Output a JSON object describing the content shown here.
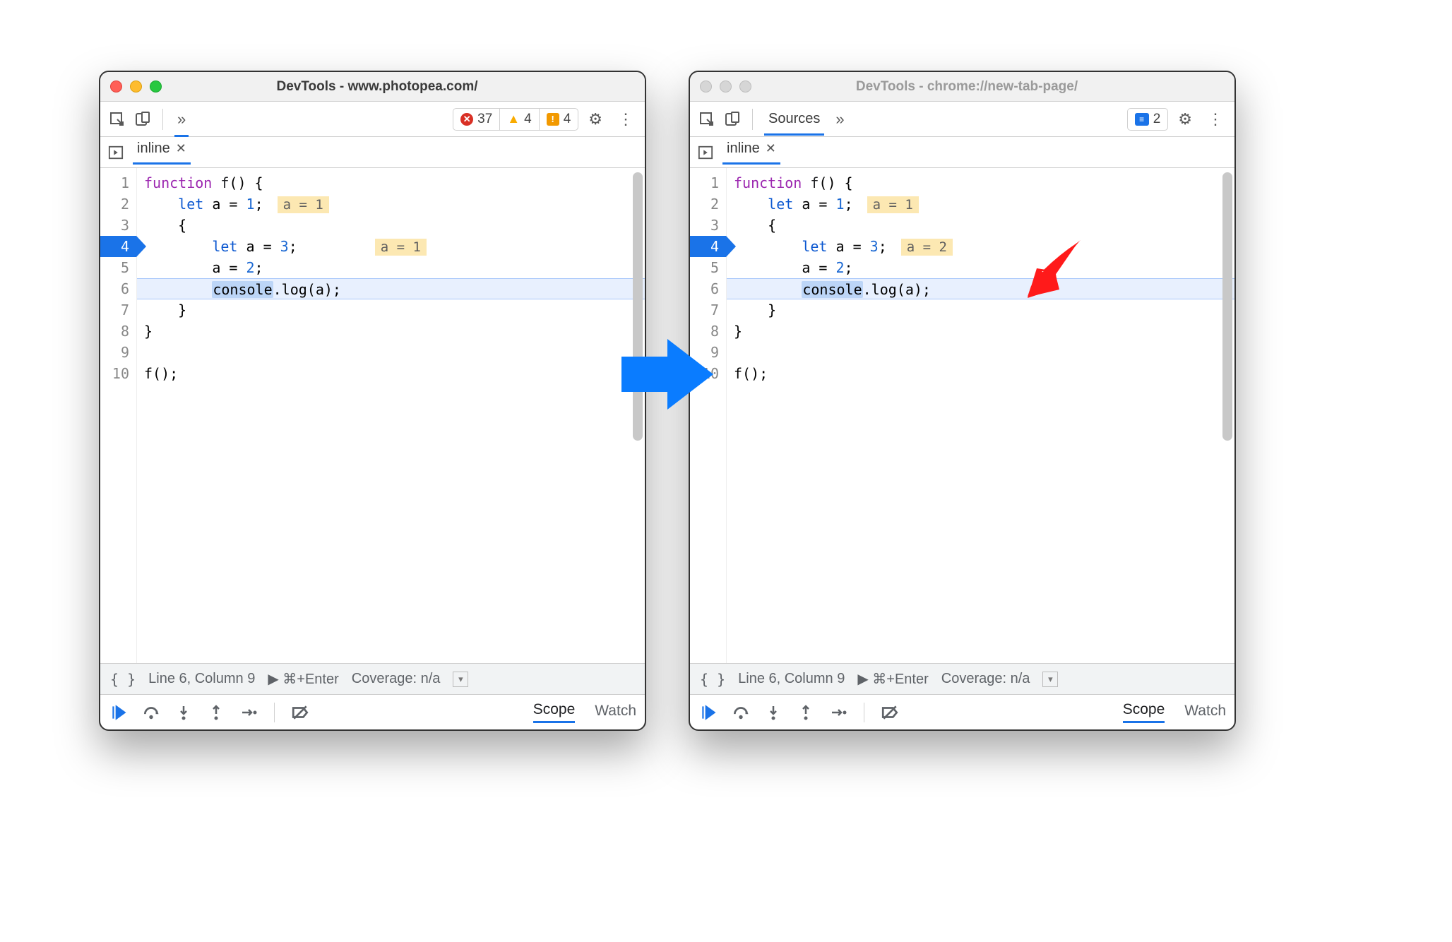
{
  "windows": {
    "left": {
      "title": "DevTools - www.photopea.com/",
      "active": true,
      "badges": {
        "errors": "37",
        "warnings": "4",
        "issues": "4"
      },
      "tabs": {
        "chevron": "»"
      },
      "file_tab": "inline",
      "gutter": [
        "1",
        "2",
        "3",
        "4",
        "5",
        "6",
        "7",
        "8",
        "9",
        "10"
      ],
      "exec_line_index": 3,
      "current_line_index": 5,
      "hints": {
        "line2": "a = 1",
        "line4": "a = 1"
      },
      "code": {
        "l1": {
          "kw": "function",
          "name": "f",
          "rest": "() {"
        },
        "l2": {
          "indent": "    ",
          "kw": "let",
          "assign": " a = ",
          "val": "1",
          "tail": ";"
        },
        "l3": {
          "indent": "    ",
          "brace": "{"
        },
        "l4": {
          "indent": "        ",
          "kw": "let",
          "assign": " a = ",
          "val": "3",
          "tail": ";"
        },
        "l5": {
          "indent": "        ",
          "text": "a = ",
          "val": "2",
          "tail": ";"
        },
        "l6": {
          "indent": "        ",
          "sel": "console",
          "rest": ".log(a);"
        },
        "l7": {
          "indent": "    ",
          "brace": "}"
        },
        "l8": {
          "brace": "}"
        },
        "l9": "",
        "l10": "f();"
      },
      "status": {
        "pos": "Line 6, Column 9",
        "run": "⌘+Enter",
        "coverage": "Coverage: n/a"
      },
      "panes": {
        "scope": "Scope",
        "watch": "Watch"
      }
    },
    "right": {
      "title": "DevTools - chrome://new-tab-page/",
      "active": false,
      "tab_label": "Sources",
      "badges": {
        "messages": "2"
      },
      "tabs": {
        "chevron": "»"
      },
      "file_tab": "inline",
      "gutter": [
        "1",
        "2",
        "3",
        "4",
        "5",
        "6",
        "7",
        "8",
        "9",
        "10"
      ],
      "exec_line_index": 3,
      "current_line_index": 5,
      "hints": {
        "line2": "a = 1",
        "line4": "a = 2"
      },
      "code": {
        "l1": {
          "kw": "function",
          "name": "f",
          "rest": "() {"
        },
        "l2": {
          "indent": "    ",
          "kw": "let",
          "assign": " a = ",
          "val": "1",
          "tail": ";"
        },
        "l3": {
          "indent": "    ",
          "brace": "{"
        },
        "l4": {
          "indent": "        ",
          "kw": "let",
          "assign": " a = ",
          "val": "3",
          "tail": ";"
        },
        "l5": {
          "indent": "        ",
          "text": "a = ",
          "val": "2",
          "tail": ";"
        },
        "l6": {
          "indent": "        ",
          "sel": "console",
          "rest": ".log(a);"
        },
        "l7": {
          "indent": "    ",
          "brace": "}"
        },
        "l8": {
          "brace": "}"
        },
        "l9": "",
        "l10": "f();"
      },
      "status": {
        "pos": "Line 6, Column 9",
        "run": "⌘+Enter",
        "coverage": "Coverage: n/a"
      },
      "panes": {
        "scope": "Scope",
        "watch": "Watch"
      }
    }
  }
}
